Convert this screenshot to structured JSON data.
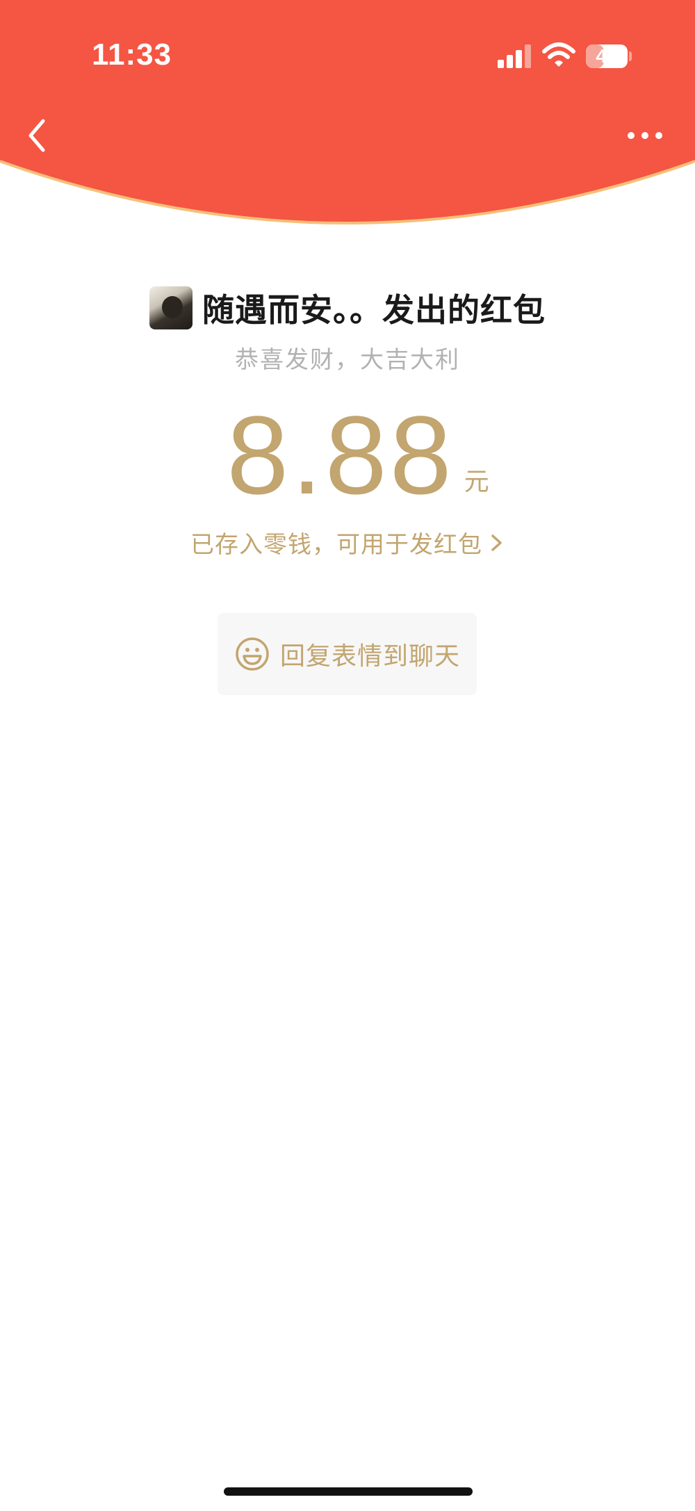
{
  "status_bar": {
    "time": "11:33",
    "battery_level": "43",
    "battery_fraction": 0.43,
    "signal_icon": "cellular-signal-icon",
    "wifi_icon": "wifi-icon"
  },
  "nav": {
    "back_icon": "chevron-left-icon",
    "more_icon": "more-horizontal-icon"
  },
  "sender": {
    "title": "随遇而安。。发出的红包"
  },
  "greeting": "恭喜发财，大吉大利",
  "amount": {
    "value": "8.88",
    "unit": "元"
  },
  "wallet_link": {
    "label": "已存入零钱，可用于发红包"
  },
  "reply_button": {
    "label": "回复表情到聊天",
    "icon": "smile-icon"
  },
  "colors": {
    "header_red": "#f55543",
    "header_edge": "#f5c07a",
    "gold": "#c2a56f",
    "greeting_gray": "#b2b2b2",
    "reply_bg": "#f7f7f7"
  }
}
